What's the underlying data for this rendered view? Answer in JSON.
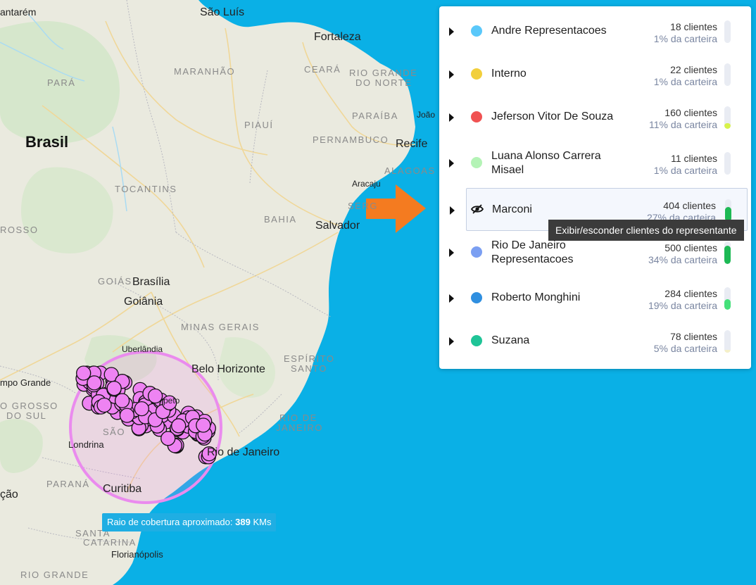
{
  "map": {
    "country_label": "Brasil",
    "state_labels": [
      "PARÁ",
      "MARANHÃO",
      "CEARÁ",
      "RIO GRANDE",
      "DO NORTE",
      "PARAÍBA",
      "PIAUÍ",
      "PERNAMBUCO",
      "ALAGOAS",
      "TOCANTINS",
      "SERG",
      "BAHIA",
      "ROSSO",
      "GOIÁS",
      "MINAS GERAIS",
      "ESPÍRITO",
      "SANTO",
      "RIO DE",
      "JANEIRO",
      "O GROSSO",
      "DO SUL",
      "PARANÁ",
      "SANTA",
      "CATARINA",
      "RIO GRANDE",
      "SÃO"
    ],
    "city_labels": [
      "antarém",
      "São Luís",
      "Fortaleza",
      "João",
      "Recife",
      "Aracaju",
      "Salvador",
      "Brasília",
      "Goiânia",
      "Uberlândia",
      "Belo Horizonte",
      "mpo Grande",
      "Londrina",
      "Rio de Janeiro",
      "Curitiba",
      "Florianópolis",
      "ção",
      "peto"
    ]
  },
  "coverage": {
    "label": "Raio de cobertura aproximado:",
    "value": "389",
    "unit": "KMs"
  },
  "tooltip": "Exibir/esconder clientes do representante",
  "representatives": [
    {
      "name": "Andre Representacoes",
      "clients": "18 clientes",
      "share": "1% da carteira",
      "color": "#5ac8fa",
      "fill_pct": 1,
      "bar_color": "#e9ecf3"
    },
    {
      "name": "Interno",
      "clients": "22 clientes",
      "share": "1% da carteira",
      "color": "#f2cf3b",
      "fill_pct": 1,
      "bar_color": "#e9ecf3"
    },
    {
      "name": "Jeferson Vitor De Souza",
      "clients": "160 clientes",
      "share": "11% da carteira",
      "color": "#f05252",
      "fill_pct": 11,
      "bar_color": "#d7f24a"
    },
    {
      "name": "Luana Alonso Carrera Misael",
      "clients": "11 clientes",
      "share": "1% da carteira",
      "color": "#b4f3b6",
      "fill_pct": 1,
      "bar_color": "#e9ecf3"
    },
    {
      "name": "Marconi",
      "clients": "404 clientes",
      "share": "27% da carteira",
      "color": "#111111",
      "fill_pct": 27,
      "bar_color": "#1db954",
      "hidden_icon": "eye-off-icon"
    },
    {
      "name": "Rio De Janeiro Representacoes",
      "clients": "500 clientes",
      "share": "34% da carteira",
      "color": "#7b9ff2",
      "fill_pct": 34,
      "bar_color": "#1db954"
    },
    {
      "name": "Roberto Monghini",
      "clients": "284 clientes",
      "share": "19% da carteira",
      "color": "#2f8fe0",
      "fill_pct": 19,
      "bar_color": "#45e07a"
    },
    {
      "name": "Suzana",
      "clients": "78 clientes",
      "share": "5% da carteira",
      "color": "#1fc497",
      "fill_pct": 5,
      "bar_color": "#f5f0c8"
    }
  ]
}
